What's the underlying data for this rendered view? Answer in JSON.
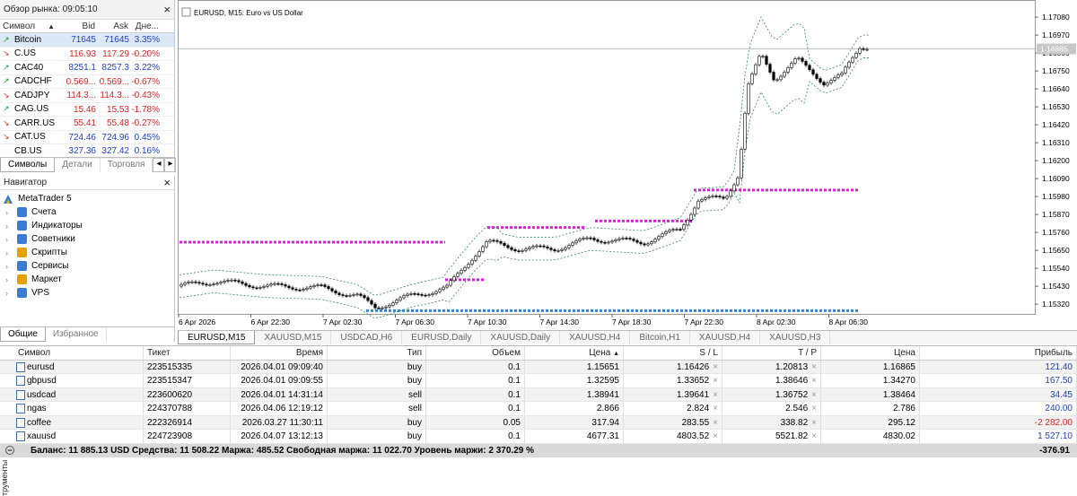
{
  "market_watch": {
    "title": "Обзор рынка: 09:05:10",
    "columns": [
      "Символ",
      "Bid",
      "Ask",
      "Дне..."
    ],
    "rows": [
      {
        "symbol": "Bitcoin",
        "dir": "up",
        "bid": "71645",
        "ask": "71645",
        "chg": "3.35%",
        "neg": false
      },
      {
        "symbol": "C.US",
        "dir": "down",
        "bid": "116.93",
        "ask": "117.29",
        "chg": "-0.20%",
        "neg": true
      },
      {
        "symbol": "CAC40",
        "dir": "up",
        "bid": "8251.1",
        "ask": "8257.3",
        "chg": "3.22%",
        "neg": false
      },
      {
        "symbol": "CADCHF",
        "dir": "up",
        "bid": "0.569...",
        "ask": "0.569...",
        "chg": "-0.67%",
        "neg": true
      },
      {
        "symbol": "CADJPY",
        "dir": "down",
        "bid": "114.3...",
        "ask": "114.3...",
        "chg": "-0.43%",
        "neg": true
      },
      {
        "symbol": "CAG.US",
        "dir": "up",
        "bid": "15.46",
        "ask": "15.53",
        "chg": "-1.78%",
        "neg": true
      },
      {
        "symbol": "CARR.US",
        "dir": "down",
        "bid": "55.41",
        "ask": "55.48",
        "chg": "-0.27%",
        "neg": true
      },
      {
        "symbol": "CAT.US",
        "dir": "down",
        "bid": "724.46",
        "ask": "724.96",
        "chg": "0.45%",
        "neg": false
      },
      {
        "symbol": "CB.US",
        "dir": "none",
        "bid": "327.36",
        "ask": "327.42",
        "chg": "0.16%",
        "neg": false
      }
    ],
    "tabs": [
      "Символы",
      "Детали",
      "Торговля"
    ]
  },
  "navigator": {
    "title": "Навигатор",
    "root": "MetaTrader 5",
    "items": [
      "Счета",
      "Индикаторы",
      "Советники",
      "Скрипты",
      "Сервисы",
      "Маркет",
      "VPS"
    ],
    "tabs": [
      "Общие",
      "Избранное"
    ]
  },
  "chart": {
    "title": "EURUSD, M15:  Euro vs US Dollar",
    "current_price": "1.16885",
    "price_ticks": [
      "1.17080",
      "1.16970",
      "1.16860",
      "1.16750",
      "1.16640",
      "1.16530",
      "1.16420",
      "1.16310",
      "1.16200",
      "1.16090",
      "1.15980",
      "1.15870",
      "1.15760",
      "1.15650",
      "1.15540",
      "1.15430",
      "1.15320"
    ],
    "time_ticks": [
      "6 Apr 2026",
      "6 Apr 22:30",
      "7 Apr 02:30",
      "7 Apr 06:30",
      "7 Apr 10:30",
      "7 Apr 14:30",
      "7 Apr 18:30",
      "7 Apr 22:30",
      "8 Apr 02:30",
      "8 Apr 06:30"
    ],
    "colors": {
      "candle": "#000000",
      "band": "#2e8b57",
      "level_magenta": "#e020e0",
      "level_blue": "#2f86e0",
      "price_line": "#a0a0a0"
    }
  },
  "chart_tabs": [
    "EURUSD,M15",
    "XAUUSD,M15",
    "USDCAD,H6",
    "EURUSD,Daily",
    "XAUUSD,Daily",
    "XAUUSD,H4",
    "Bitcoin,H1",
    "XAUUSD,H4",
    "XAUUSD,H3"
  ],
  "trade": {
    "columns": [
      "Символ",
      "Тикет",
      "Время",
      "Тип",
      "Объем",
      "Цена",
      "S / L",
      "T / P",
      "Цена",
      "Прибыль"
    ],
    "rows": [
      {
        "symbol": "eurusd",
        "ticket": "223515335",
        "time": "2026.04.01 09:09:40",
        "type": "buy",
        "volume": "0.1",
        "price": "1.15651",
        "sl": "1.16426",
        "tp": "1.20813",
        "cur": "1.16865",
        "profit": "121.40",
        "neg": false
      },
      {
        "symbol": "gbpusd",
        "ticket": "223515347",
        "time": "2026.04.01 09:09:55",
        "type": "buy",
        "volume": "0.1",
        "price": "1.32595",
        "sl": "1.33652",
        "tp": "1.38646",
        "cur": "1.34270",
        "profit": "167.50",
        "neg": false
      },
      {
        "symbol": "usdcad",
        "ticket": "223600620",
        "time": "2026.04.01 14:31:14",
        "type": "sell",
        "volume": "0.1",
        "price": "1.38941",
        "sl": "1.39641",
        "tp": "1.36752",
        "cur": "1.38464",
        "profit": "34.45",
        "neg": false
      },
      {
        "symbol": "ngas",
        "ticket": "224370788",
        "time": "2026.04.06 12:19:12",
        "type": "sell",
        "volume": "0.1",
        "price": "2.866",
        "sl": "2.824",
        "tp": "2.546",
        "cur": "2.786",
        "profit": "240.00",
        "neg": false
      },
      {
        "symbol": "coffee",
        "ticket": "222326914",
        "time": "2026.03.27 11:30:11",
        "type": "buy",
        "volume": "0.05",
        "price": "317.94",
        "sl": "283.55",
        "tp": "338.82",
        "cur": "295.12",
        "profit": "-2 282.00",
        "neg": true
      },
      {
        "symbol": "xauusd",
        "ticket": "224723908",
        "time": "2026.04.07 13:12:13",
        "type": "buy",
        "volume": "0.1",
        "price": "4677.31",
        "sl": "4803.52",
        "tp": "5521.82",
        "cur": "4830.02",
        "profit": "1 527.10",
        "neg": false
      }
    ],
    "balance_text": "Баланс: 11 885.13 USD  Средства: 11 508.22  Маржа: 485.52  Свободная маржа: 11 022.70  Уровень маржи: 2 370.29 %",
    "total": "-376.91",
    "side_tab": "трументы"
  }
}
